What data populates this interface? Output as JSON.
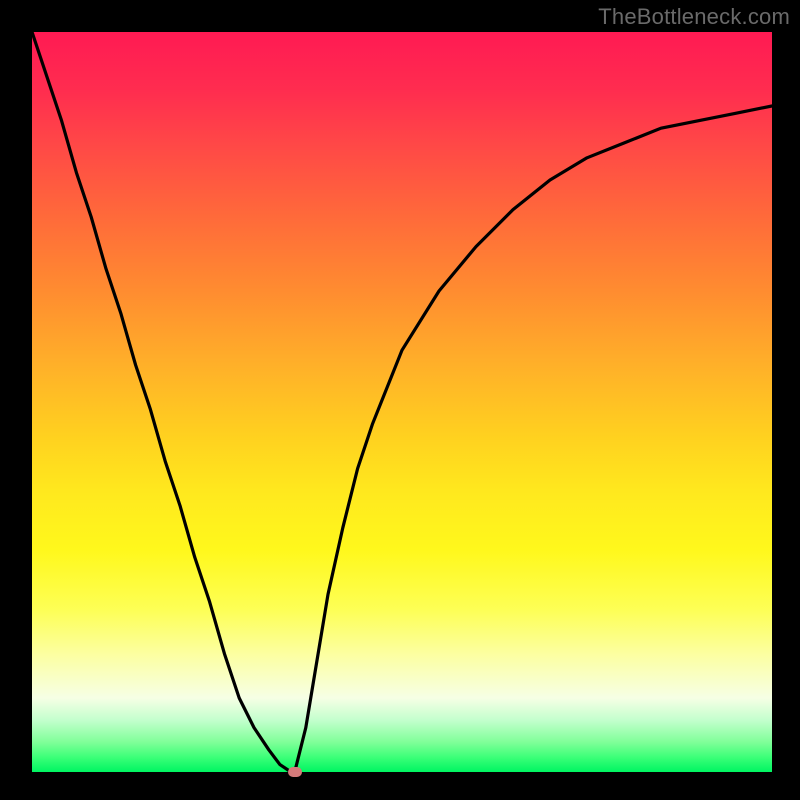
{
  "watermark": "TheBottleneck.com",
  "chart_data": {
    "type": "line",
    "title": "",
    "xlabel": "",
    "ylabel": "",
    "x": [
      0.0,
      0.02,
      0.04,
      0.06,
      0.08,
      0.1,
      0.12,
      0.14,
      0.16,
      0.18,
      0.2,
      0.22,
      0.24,
      0.26,
      0.28,
      0.3,
      0.32,
      0.335,
      0.35,
      0.355,
      0.36,
      0.37,
      0.38,
      0.4,
      0.42,
      0.44,
      0.46,
      0.48,
      0.5,
      0.55,
      0.6,
      0.65,
      0.7,
      0.75,
      0.8,
      0.85,
      0.9,
      0.95,
      1.0
    ],
    "y": [
      1.0,
      0.94,
      0.88,
      0.81,
      0.75,
      0.68,
      0.62,
      0.55,
      0.49,
      0.42,
      0.36,
      0.29,
      0.23,
      0.16,
      0.1,
      0.06,
      0.03,
      0.01,
      0.0,
      0.0,
      0.02,
      0.06,
      0.12,
      0.24,
      0.33,
      0.41,
      0.47,
      0.52,
      0.57,
      0.65,
      0.71,
      0.76,
      0.8,
      0.83,
      0.85,
      0.87,
      0.88,
      0.89,
      0.9
    ],
    "xlim": [
      0,
      1
    ],
    "ylim": [
      0,
      1
    ],
    "minimum_marker": {
      "x": 0.355,
      "y": 0.0
    },
    "background_gradient": {
      "direction": "vertical",
      "stops": [
        {
          "pos": 0.0,
          "color": "#ff1a53"
        },
        {
          "pos": 0.35,
          "color": "#ff8c30"
        },
        {
          "pos": 0.62,
          "color": "#ffe81e"
        },
        {
          "pos": 0.9,
          "color": "#f6ffe5"
        },
        {
          "pos": 1.0,
          "color": "#00f562"
        }
      ]
    },
    "frame_color": "#000000",
    "curve_color": "#000000"
  }
}
